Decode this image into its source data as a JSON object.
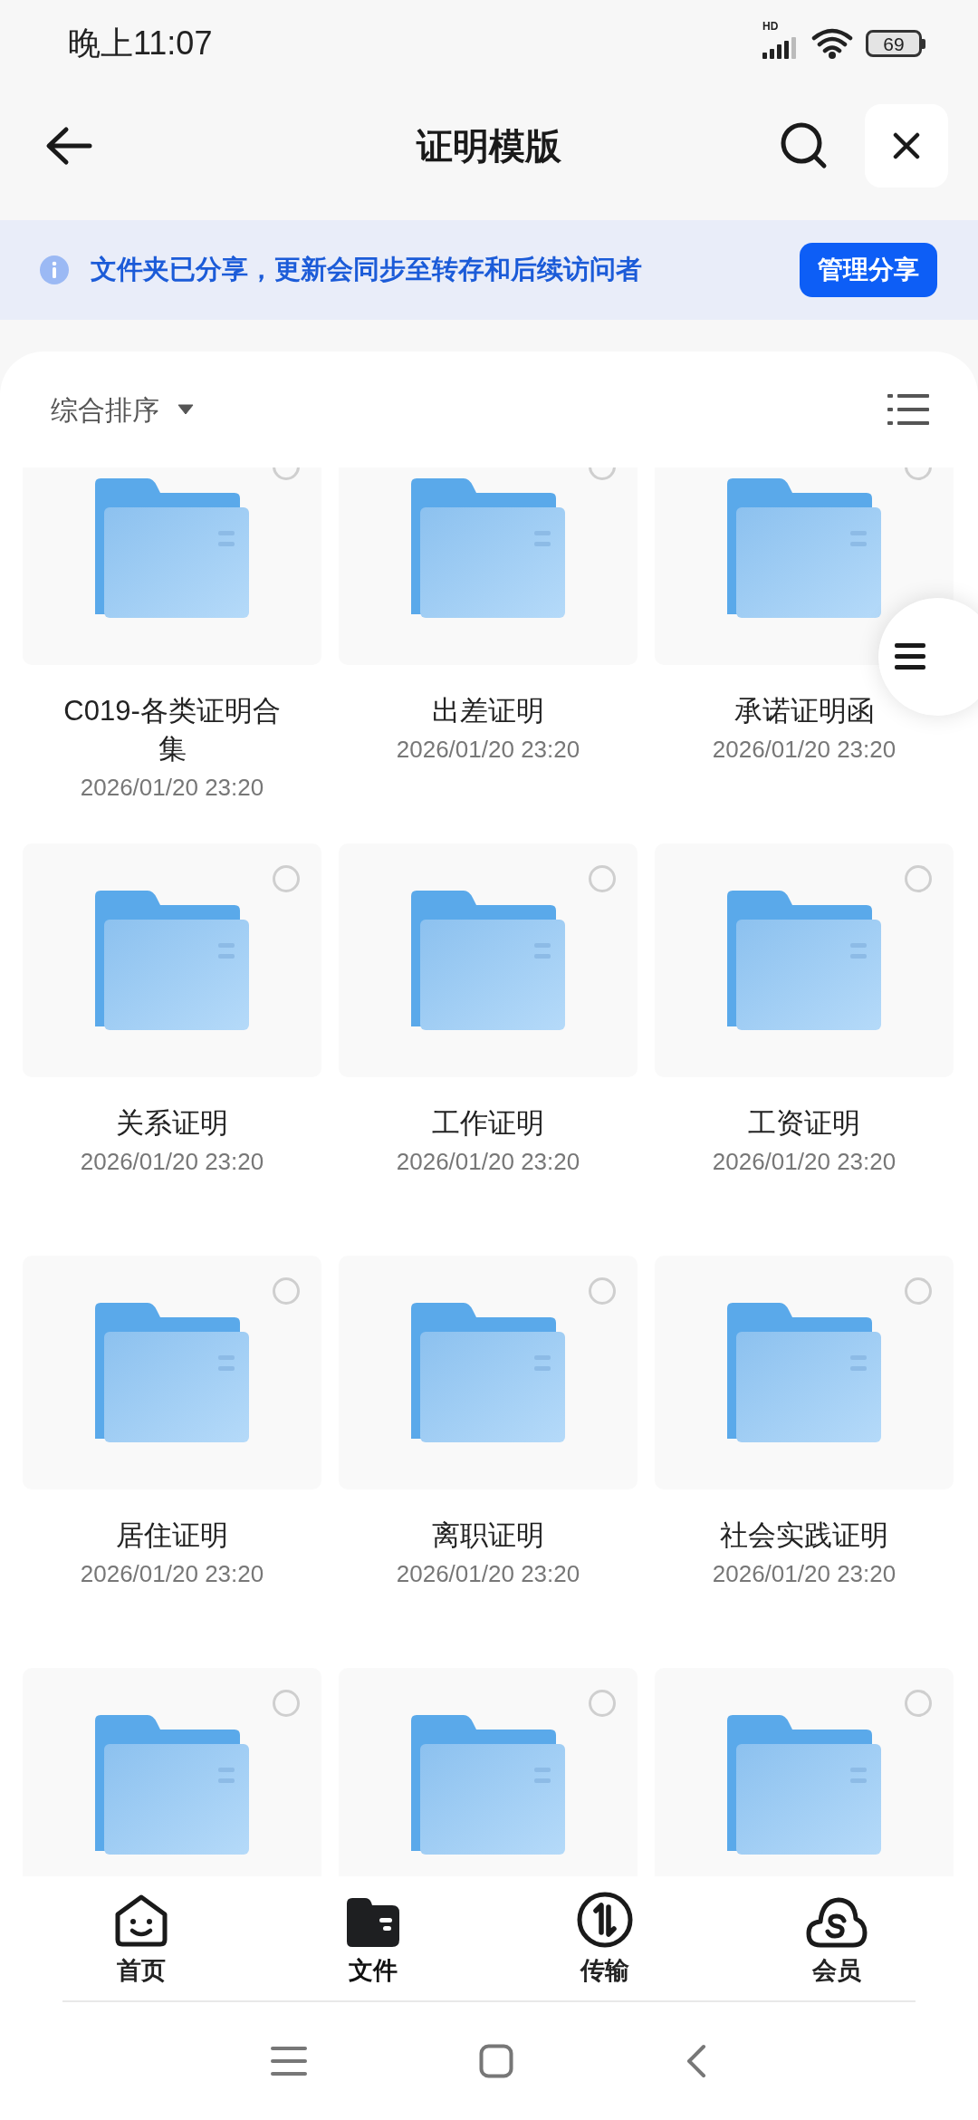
{
  "status_bar": {
    "time": "晚上11:07",
    "network": "HD",
    "battery": "69"
  },
  "header": {
    "title": "证明模版"
  },
  "banner": {
    "text": "文件夹已分享，更新会同步至转存和后续访问者",
    "button": "管理分享"
  },
  "sort": {
    "label": "综合排序"
  },
  "items": [
    {
      "name": "C019-各类证明合集",
      "date": "2026/01/20 23:20",
      "selected": false
    },
    {
      "name": "出差证明",
      "date": "2026/01/20 23:20",
      "selected": false
    },
    {
      "name": "承诺证明函",
      "date": "2026/01/20 23:20",
      "selected": false
    },
    {
      "name": "关系证明",
      "date": "2026/01/20 23:20",
      "selected": false
    },
    {
      "name": "工作证明",
      "date": "2026/01/20 23:20",
      "selected": false
    },
    {
      "name": "工资证明",
      "date": "2026/01/20 23:20",
      "selected": false
    },
    {
      "name": "居住证明",
      "date": "2026/01/20 23:20",
      "selected": false
    },
    {
      "name": "离职证明",
      "date": "2026/01/20 23:20",
      "selected": false
    },
    {
      "name": "社会实践证明",
      "date": "2026/01/20 23:20",
      "selected": false
    },
    {
      "selected": false
    },
    {
      "selected": false
    },
    {
      "selected": false
    }
  ],
  "bottom_nav": [
    {
      "kind": "home",
      "label": "首页",
      "selected": false
    },
    {
      "kind": "files",
      "label": "文件",
      "selected": true
    },
    {
      "kind": "transfer",
      "label": "传输",
      "selected": false
    },
    {
      "kind": "vip",
      "label": "会员",
      "selected": false
    }
  ]
}
